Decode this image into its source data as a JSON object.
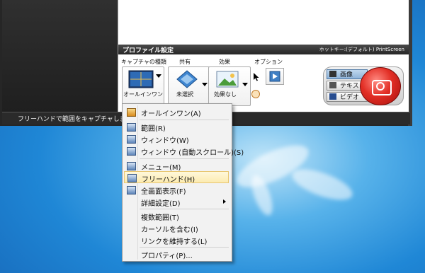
{
  "profile": {
    "title": "プロファイル設定",
    "hotkey": "ホットキー:(デフォルト) PrintScreen"
  },
  "toolbar": {
    "capture_type_label": "キャプチャの種類",
    "capture_type_value": "オールインワン",
    "share_label": "共有",
    "share_value": "未選択",
    "effects_label": "効果",
    "effects_value": "効果なし",
    "options_label": "オプション"
  },
  "modes": {
    "image": "画像",
    "text": "テキスト",
    "video": "ビデオ",
    "active": "image"
  },
  "status": {
    "text": "フリーハンドで範囲をキャプチャします"
  },
  "menu": {
    "items": [
      {
        "label": "オールインワン(A)"
      },
      {
        "label": "範囲(R)"
      },
      {
        "label": "ウィンドウ(W)"
      },
      {
        "label": "ウィンドウ (自動スクロール)(S)"
      },
      {
        "label": "メニュー(M)"
      },
      {
        "label": "フリーハンド(H)",
        "highlighted": true
      },
      {
        "label": "全画面表示(F)"
      },
      {
        "label": "詳細設定(D)",
        "submenu": true
      },
      {
        "label": "複数範囲(T)"
      },
      {
        "label": "カーソルを含む(I)"
      },
      {
        "label": "リンクを維持する(L)"
      },
      {
        "label": "プロパティ(P)..."
      }
    ]
  },
  "colors": {
    "desktop": "#2a8ee0",
    "capture_button": "#d92b22",
    "menu_highlight": "#fcebb0"
  }
}
